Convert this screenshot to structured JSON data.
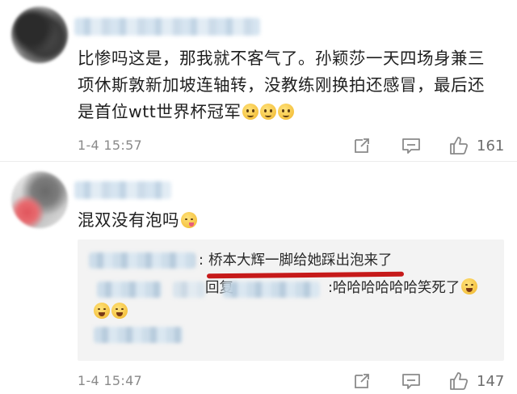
{
  "comments": [
    {
      "text": "比惨吗这是，那我就不客气了。孙颖莎一天四场身兼三项休斯敦新加坡连轴转，没教练刚换拍还感冒，最后还是首位wtt世界杯冠军",
      "emojis": [
        "sad-face",
        "sad-face",
        "sad-face"
      ],
      "time": "1-4 15:57",
      "like_count": "161"
    },
    {
      "text": "混双没有泡吗",
      "emojis": [
        "yum-face"
      ],
      "time": "1-4 15:47",
      "like_count": "147",
      "replies": [
        {
          "colon": ":",
          "text": "桥本大辉一脚给她踩出泡来了",
          "underline_color": "#c61a1a"
        },
        {
          "reply_word": "回复",
          "text": ":哈哈哈哈哈哈笑死了"
        }
      ]
    }
  ],
  "colors": {
    "text": "#1f1f1f",
    "meta": "#8a8a8a",
    "reply_bg": "#f3f3f3",
    "highlight": "#c61a1a"
  }
}
